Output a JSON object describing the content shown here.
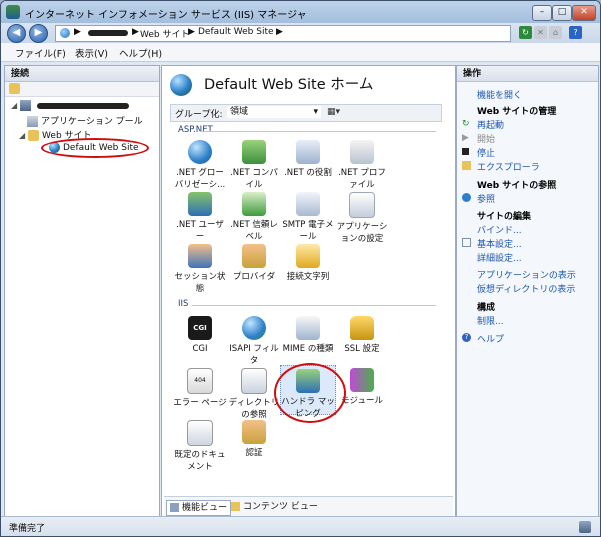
{
  "window": {
    "title": "インターネット インフォメーション サービス (IIS) マネージャ",
    "controls": {
      "minimize": "–",
      "maximize": "□",
      "close": "✕"
    }
  },
  "address": {
    "breadcrumbs": [
      "Web サイト",
      "Default Web Site"
    ],
    "separator": "▶"
  },
  "menu": {
    "items": [
      "ファイル(F)",
      "表示(V)",
      "ヘルプ(H)"
    ]
  },
  "connections": {
    "title": "接続",
    "tree": {
      "sites": "Web サイト",
      "app_pools": "アプリケーション プール",
      "default_site": "Default Web Site"
    }
  },
  "center": {
    "title": "Default Web Site ホーム",
    "group_label": "グループ化:",
    "group_value": "領域",
    "sections": [
      {
        "name": "ASP.NET",
        "features": [
          {
            "label": ".NET グローバリゼーシ...",
            "icon": "globe-icon"
          },
          {
            "label": ".NET コンパイル",
            "icon": "compile-icon"
          },
          {
            "label": ".NET の役割",
            "icon": "roles-icon"
          },
          {
            "label": ".NET プロファイル",
            "icon": "profile-icon"
          },
          {
            "label": ".NET ユーザー",
            "icon": "users-icon"
          },
          {
            "label": ".NET 信頼レベル",
            "icon": "trust-icon"
          },
          {
            "label": "SMTP 電子メール",
            "icon": "mail-icon"
          },
          {
            "label": "アプリケーションの設定",
            "icon": "app-settings-icon"
          },
          {
            "label": "セッション状態",
            "icon": "session-icon"
          },
          {
            "label": "プロバイダ",
            "icon": "provider-icon"
          },
          {
            "label": "接続文字列",
            "icon": "connection-string-icon"
          }
        ]
      },
      {
        "name": "IIS",
        "features": [
          {
            "label": "CGI",
            "icon": "cgi-icon"
          },
          {
            "label": "ISAPI フィルタ",
            "icon": "isapi-icon"
          },
          {
            "label": "MIME の種類",
            "icon": "mime-icon"
          },
          {
            "label": "SSL 設定",
            "icon": "lock-icon"
          },
          {
            "label": "エラー ページ",
            "icon": "error-page-icon"
          },
          {
            "label": "ディレクトリの参照",
            "icon": "directory-icon"
          },
          {
            "label": "ハンドラ マッピング",
            "icon": "handler-icon"
          },
          {
            "label": "モジュール",
            "icon": "module-icon"
          },
          {
            "label": "既定のドキュメント",
            "icon": "default-doc-icon"
          },
          {
            "label": "認証",
            "icon": "auth-icon"
          }
        ]
      }
    ],
    "tabs": [
      "機能ビュー",
      "コンテンツ ビュー"
    ]
  },
  "actions": {
    "title": "操作",
    "items": [
      {
        "label": "機能を開く",
        "kind": "link"
      },
      {
        "label": "Web サイトの管理",
        "kind": "head"
      },
      {
        "label": "再起動",
        "kind": "link"
      },
      {
        "label": "開始",
        "kind": "disabled"
      },
      {
        "label": "停止",
        "kind": "link"
      },
      {
        "label": "エクスプローラ",
        "kind": "link"
      },
      {
        "label": "Web サイトの参照",
        "kind": "head"
      },
      {
        "label": "参照",
        "kind": "link"
      },
      {
        "label": "サイトの編集",
        "kind": "head"
      },
      {
        "label": "バインド...",
        "kind": "link"
      },
      {
        "label": "基本設定...",
        "kind": "link"
      },
      {
        "label": "詳細設定...",
        "kind": "link"
      },
      {
        "label": "アプリケーションの表示",
        "kind": "link"
      },
      {
        "label": "仮想ディレクトリの表示",
        "kind": "link"
      },
      {
        "label": "構成",
        "kind": "head"
      },
      {
        "label": "制限...",
        "kind": "link"
      },
      {
        "label": "ヘルプ",
        "kind": "link"
      }
    ]
  },
  "status": {
    "text": "準備完了"
  },
  "colors": {
    "accent": "#1d56b0",
    "highlight": "#d10d0d"
  }
}
